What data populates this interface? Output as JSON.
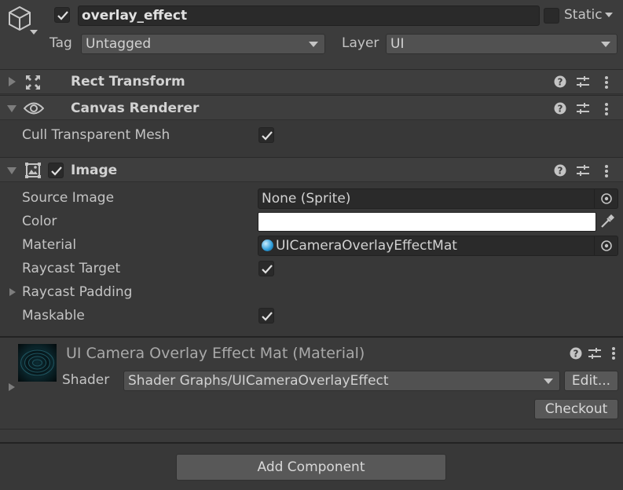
{
  "gameobject": {
    "name": "overlay_effect",
    "active": true,
    "static_label": "Static",
    "static_checked": false,
    "tag_label": "Tag",
    "tag_value": "Untagged",
    "layer_label": "Layer",
    "layer_value": "UI"
  },
  "components": {
    "rect_transform": {
      "title": "Rect Transform"
    },
    "canvas_renderer": {
      "title": "Canvas Renderer",
      "cull_label": "Cull Transparent Mesh",
      "cull_checked": true
    },
    "image": {
      "title": "Image",
      "enabled": true,
      "source_image_label": "Source Image",
      "source_image_value": "None (Sprite)",
      "color_label": "Color",
      "color_value": "#ffffff",
      "material_label": "Material",
      "material_value": "UICameraOverlayEffectMat",
      "raycast_target_label": "Raycast Target",
      "raycast_target_checked": true,
      "raycast_padding_label": "Raycast Padding",
      "maskable_label": "Maskable",
      "maskable_checked": true
    }
  },
  "material": {
    "title": "UI Camera Overlay Effect Mat (Material)",
    "shader_label": "Shader",
    "shader_value": "Shader Graphs/UICameraOverlayEffect",
    "edit_label": "Edit...",
    "checkout_label": "Checkout"
  },
  "footer": {
    "add_component_label": "Add Component"
  },
  "icons": {
    "gameobject": "cube-icon",
    "rect_transform": "rect-transform-icon",
    "canvas_renderer": "eye-icon",
    "image": "image-icon",
    "help": "help-icon",
    "presets": "sliders-icon",
    "menu": "kebab-menu-icon",
    "object_picker": "object-picker-icon",
    "eyedropper": "eyedropper-icon"
  }
}
